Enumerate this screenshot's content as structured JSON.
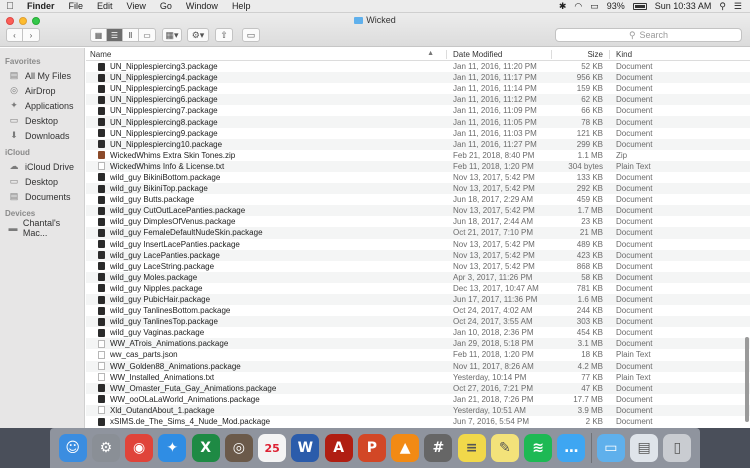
{
  "menubar": {
    "apple": "",
    "items": [
      "Finder",
      "File",
      "Edit",
      "View",
      "Go",
      "Window",
      "Help"
    ],
    "battery": "93%",
    "clock": "Sun 10:33 AM"
  },
  "window": {
    "title": "Wicked",
    "search_placeholder": "Search"
  },
  "sidebar": {
    "favorites_header": "Favorites",
    "favorites": [
      {
        "label": "All My Files",
        "icon": "all-files-icon"
      },
      {
        "label": "AirDrop",
        "icon": "airdrop-icon"
      },
      {
        "label": "Applications",
        "icon": "applications-icon"
      },
      {
        "label": "Desktop",
        "icon": "desktop-icon"
      },
      {
        "label": "Downloads",
        "icon": "downloads-icon"
      }
    ],
    "icloud_header": "iCloud",
    "icloud": [
      {
        "label": "iCloud Drive",
        "icon": "cloud-icon"
      },
      {
        "label": "Desktop",
        "icon": "desktop-icon"
      },
      {
        "label": "Documents",
        "icon": "documents-icon"
      }
    ],
    "devices_header": "Devices",
    "devices": [
      {
        "label": "Chantal's Mac...",
        "icon": "laptop-icon"
      }
    ]
  },
  "columns": {
    "name": "Name",
    "date": "Date Modified",
    "size": "Size",
    "kind": "Kind"
  },
  "files": [
    {
      "name": "UN_Nipplespiercing3.package",
      "date": "Jan 11, 2016, 11:20 PM",
      "size": "52 KB",
      "kind": "Document",
      "type": "pkg"
    },
    {
      "name": "UN_Nipplespiercing4.package",
      "date": "Jan 11, 2016, 11:17 PM",
      "size": "956 KB",
      "kind": "Document",
      "type": "pkg"
    },
    {
      "name": "UN_Nipplespiercing5.package",
      "date": "Jan 11, 2016, 11:14 PM",
      "size": "159 KB",
      "kind": "Document",
      "type": "pkg"
    },
    {
      "name": "UN_Nipplespiercing6.package",
      "date": "Jan 11, 2016, 11:12 PM",
      "size": "62 KB",
      "kind": "Document",
      "type": "pkg"
    },
    {
      "name": "UN_Nipplespiercing7.package",
      "date": "Jan 11, 2016, 11:09 PM",
      "size": "66 KB",
      "kind": "Document",
      "type": "pkg"
    },
    {
      "name": "UN_Nipplespiercing8.package",
      "date": "Jan 11, 2016, 11:05 PM",
      "size": "78 KB",
      "kind": "Document",
      "type": "pkg"
    },
    {
      "name": "UN_Nipplespiercing9.package",
      "date": "Jan 11, 2016, 11:03 PM",
      "size": "121 KB",
      "kind": "Document",
      "type": "pkg"
    },
    {
      "name": "UN_Nipplespiercing10.package",
      "date": "Jan 11, 2016, 11:27 PM",
      "size": "299 KB",
      "kind": "Document",
      "type": "pkg"
    },
    {
      "name": "WickedWhims Extra Skin Tones.zip",
      "date": "Feb 21, 2018, 8:40 PM",
      "size": "1.1 MB",
      "kind": "Zip",
      "type": "zip"
    },
    {
      "name": "WickedWhims Info & License.txt",
      "date": "Feb 11, 2018, 1:20 PM",
      "size": "304 bytes",
      "kind": "Plain Text",
      "type": "txt"
    },
    {
      "name": "wild_guy BikiniBottom.package",
      "date": "Nov 13, 2017, 5:42 PM",
      "size": "133 KB",
      "kind": "Document",
      "type": "pkg"
    },
    {
      "name": "wild_guy BikiniTop.package",
      "date": "Nov 13, 2017, 5:42 PM",
      "size": "292 KB",
      "kind": "Document",
      "type": "pkg"
    },
    {
      "name": "wild_guy Butts.package",
      "date": "Jun 18, 2017, 2:29 AM",
      "size": "459 KB",
      "kind": "Document",
      "type": "pkg"
    },
    {
      "name": "wild_guy CutOutLacePanties.package",
      "date": "Nov 13, 2017, 5:42 PM",
      "size": "1.7 MB",
      "kind": "Document",
      "type": "pkg"
    },
    {
      "name": "wild_guy DimplesOfVenus.package",
      "date": "Jun 18, 2017, 2:44 AM",
      "size": "23 KB",
      "kind": "Document",
      "type": "pkg"
    },
    {
      "name": "wild_guy FemaleDefaultNudeSkin.package",
      "date": "Oct 21, 2017, 7:10 PM",
      "size": "21 MB",
      "kind": "Document",
      "type": "pkg"
    },
    {
      "name": "wild_guy InsertLacePanties.package",
      "date": "Nov 13, 2017, 5:42 PM",
      "size": "489 KB",
      "kind": "Document",
      "type": "pkg"
    },
    {
      "name": "wild_guy LacePanties.package",
      "date": "Nov 13, 2017, 5:42 PM",
      "size": "423 KB",
      "kind": "Document",
      "type": "pkg"
    },
    {
      "name": "wild_guy LaceString.package",
      "date": "Nov 13, 2017, 5:42 PM",
      "size": "868 KB",
      "kind": "Document",
      "type": "pkg"
    },
    {
      "name": "wild_guy Moles.package",
      "date": "Apr 3, 2017, 11:26 PM",
      "size": "58 KB",
      "kind": "Document",
      "type": "pkg"
    },
    {
      "name": "wild_guy Nipples.package",
      "date": "Dec 13, 2017, 10:47 AM",
      "size": "781 KB",
      "kind": "Document",
      "type": "pkg"
    },
    {
      "name": "wild_guy PubicHair.package",
      "date": "Jun 17, 2017, 11:36 PM",
      "size": "1.6 MB",
      "kind": "Document",
      "type": "pkg"
    },
    {
      "name": "wild_guy TanlinesBottom.package",
      "date": "Oct 24, 2017, 4:02 AM",
      "size": "244 KB",
      "kind": "Document",
      "type": "pkg"
    },
    {
      "name": "wild_guy TanlinesTop.package",
      "date": "Oct 24, 2017, 3:55 AM",
      "size": "303 KB",
      "kind": "Document",
      "type": "pkg"
    },
    {
      "name": "wild_guy Vaginas.package",
      "date": "Jan 10, 2018, 2:36 PM",
      "size": "454 KB",
      "kind": "Document",
      "type": "pkg"
    },
    {
      "name": "WW_ATrois_Animations.package",
      "date": "Jan 29, 2018, 5:18 PM",
      "size": "3.1 MB",
      "kind": "Document",
      "type": "txt"
    },
    {
      "name": "ww_cas_parts.json",
      "date": "Feb 11, 2018, 1:20 PM",
      "size": "18 KB",
      "kind": "Plain Text",
      "type": "json"
    },
    {
      "name": "WW_Golden88_Animations.package",
      "date": "Nov 11, 2017, 8:26 AM",
      "size": "4.2 MB",
      "kind": "Document",
      "type": "txt"
    },
    {
      "name": "WW_Installed_Animations.txt",
      "date": "Yesterday, 10:14 PM",
      "size": "77 KB",
      "kind": "Plain Text",
      "type": "txt"
    },
    {
      "name": "WW_Omaster_Futa_Gay_Animations.package",
      "date": "Oct 27, 2016, 7:21 PM",
      "size": "47 KB",
      "kind": "Document",
      "type": "pkg"
    },
    {
      "name": "WW_ooOLaLaWorld_Animations.package",
      "date": "Jan 21, 2018, 7:26 PM",
      "size": "17.7 MB",
      "kind": "Document",
      "type": "pkg"
    },
    {
      "name": "Xld_OutandAbout_1.package",
      "date": "Yesterday, 10:51 AM",
      "size": "3.9 MB",
      "kind": "Document",
      "type": "txt"
    },
    {
      "name": "xSIMS.de_The_Sims_4_Nude_Mod.package",
      "date": "Jun 7, 2016, 5:54 PM",
      "size": "2 KB",
      "kind": "Document",
      "type": "pkg"
    }
  ],
  "dock": [
    {
      "name": "finder",
      "glyph": "☺",
      "color": "#3b8de0"
    },
    {
      "name": "system-preferences",
      "glyph": "⚙",
      "color": "#8a8f96"
    },
    {
      "name": "chrome",
      "glyph": "◉",
      "color": "#e0443a"
    },
    {
      "name": "safari",
      "glyph": "✦",
      "color": "#2f8de4"
    },
    {
      "name": "excel",
      "glyph": "X",
      "color": "#1e8a44"
    },
    {
      "name": "launchpad",
      "glyph": "◎",
      "color": "#6b5a4a"
    },
    {
      "name": "calendar",
      "glyph": "25",
      "color": "#f4f4f4"
    },
    {
      "name": "word",
      "glyph": "W",
      "color": "#2b5cab"
    },
    {
      "name": "acrobat",
      "glyph": "A",
      "color": "#b01e12"
    },
    {
      "name": "powerpoint",
      "glyph": "P",
      "color": "#d24726"
    },
    {
      "name": "vlc",
      "glyph": "▲",
      "color": "#f28a14"
    },
    {
      "name": "calculator",
      "glyph": "#",
      "color": "#666666"
    },
    {
      "name": "stickies",
      "glyph": "≡",
      "color": "#f1d84a"
    },
    {
      "name": "notes",
      "glyph": "✎",
      "color": "#f3e27a"
    },
    {
      "name": "spotify",
      "glyph": "≋",
      "color": "#1db954"
    },
    {
      "name": "messages",
      "glyph": "…",
      "color": "#3ea6f2"
    },
    {
      "name": "downloads-stack",
      "glyph": "▭",
      "color": "#5fb0ec"
    },
    {
      "name": "preview",
      "glyph": "▤",
      "color": "#dfe4ea"
    },
    {
      "name": "trash",
      "glyph": "▯",
      "color": "#c9ccd1"
    }
  ]
}
